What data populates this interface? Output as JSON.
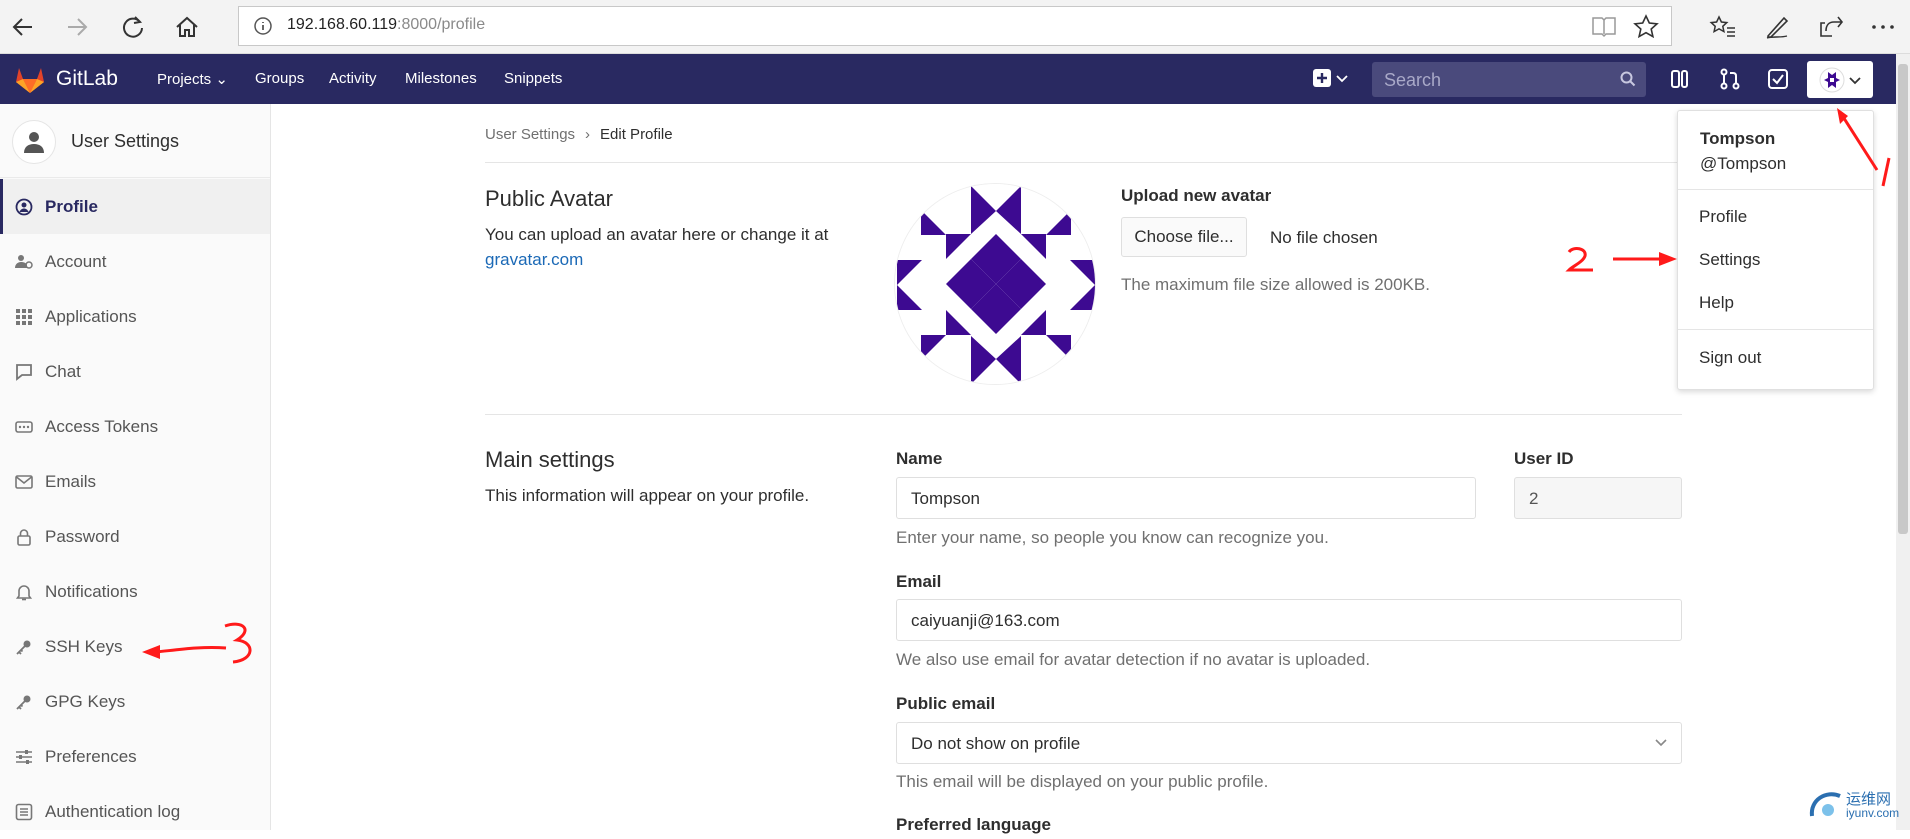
{
  "browser": {
    "url_host": "192.168.60.119",
    "url_rest": ":8000/profile"
  },
  "navbar": {
    "brand": "GitLab",
    "links": [
      "Projects",
      "Groups",
      "Activity",
      "Milestones",
      "Snippets"
    ],
    "search_placeholder": "Search"
  },
  "sidebar": {
    "title": "User Settings",
    "items": [
      {
        "label": "Profile",
        "icon": "profile-icon",
        "active": true
      },
      {
        "label": "Account",
        "icon": "account-icon"
      },
      {
        "label": "Applications",
        "icon": "applications-icon"
      },
      {
        "label": "Chat",
        "icon": "chat-icon"
      },
      {
        "label": "Access Tokens",
        "icon": "access-tokens-icon"
      },
      {
        "label": "Emails",
        "icon": "email-icon"
      },
      {
        "label": "Password",
        "icon": "lock-icon"
      },
      {
        "label": "Notifications",
        "icon": "bell-icon"
      },
      {
        "label": "SSH Keys",
        "icon": "key-icon"
      },
      {
        "label": "GPG Keys",
        "icon": "key-icon"
      },
      {
        "label": "Preferences",
        "icon": "sliders-icon"
      },
      {
        "label": "Authentication log",
        "icon": "list-icon"
      }
    ]
  },
  "breadcrumb": {
    "parent": "User Settings",
    "current": "Edit Profile"
  },
  "avatar_section": {
    "title": "Public Avatar",
    "desc": "You can upload an avatar here or change it at",
    "link": "gravatar.com",
    "upload_label": "Upload new avatar",
    "choose_button": "Choose file...",
    "no_file": "No file chosen",
    "max_size": "The maximum file size allowed is 200KB."
  },
  "main_settings": {
    "title": "Main settings",
    "desc": "This information will appear on your profile.",
    "name_label": "Name",
    "name_value": "Tompson",
    "name_help": "Enter your name, so people you know can recognize you.",
    "userid_label": "User ID",
    "userid_value": "2",
    "email_label": "Email",
    "email_value": "caiyuanji@163.com",
    "email_help": "We also use email for avatar detection if no avatar is uploaded.",
    "public_email_label": "Public email",
    "public_email_value": "Do not show on profile",
    "public_email_help": "This email will be displayed on your public profile.",
    "preferred_language_label": "Preferred language"
  },
  "user_dropdown": {
    "name": "Tompson",
    "handle": "@Tompson",
    "items": [
      "Profile",
      "Settings",
      "Help"
    ],
    "signout": "Sign out"
  },
  "watermark": {
    "text": "运维网",
    "sub": "iyunv.com"
  },
  "colors": {
    "navbar": "#292961",
    "avatar": "#3d0a91",
    "annotation": "#ff1a1a"
  }
}
